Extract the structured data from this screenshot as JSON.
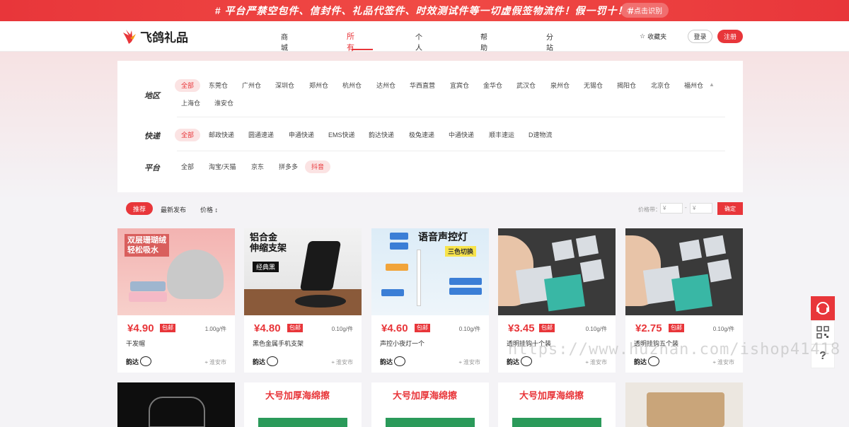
{
  "banner": {
    "text": "# 平台严禁空包件、信封件、礼品代签件、时效测试件等一切虚假签物流件！假一罚十！#",
    "button": "点击识别"
  },
  "header": {
    "logo": "飞鸽礼品",
    "nav": [
      {
        "label": "商城首页"
      },
      {
        "label": "所有商品"
      },
      {
        "label": "个人中心"
      },
      {
        "label": "帮助中心"
      },
      {
        "label": "分站加盟"
      }
    ],
    "favorites": "收藏夹",
    "login": "登录",
    "register": "注册"
  },
  "filters": {
    "region_label": "地区",
    "region_options": [
      "全部",
      "东莞仓",
      "广州仓",
      "深圳仓",
      "郑州仓",
      "杭州仓",
      "达州仓",
      "华西直营",
      "宜宾仓",
      "金华仓",
      "武汉仓",
      "泉州仓",
      "无锡仓",
      "揭阳仓",
      "北京仓",
      "福州仓",
      "上海仓",
      "淮安仓"
    ],
    "express_label": "快递",
    "express_options": [
      "全部",
      "邮政快递",
      "圆通速递",
      "申通快递",
      "EMS快递",
      "韵达快递",
      "极兔速递",
      "中通快递",
      "顺丰速运",
      "D速物流"
    ],
    "platform_label": "平台",
    "platform_options": [
      "全部",
      "淘宝/天猫",
      "京东",
      "拼多多",
      "抖音"
    ]
  },
  "sort": {
    "recommend": "推荐",
    "latest": "最新发布",
    "price": "价格",
    "price_range_label": "价格带：",
    "min_placeholder": "¥",
    "max_placeholder": "¥",
    "confirm": "确定"
  },
  "products": [
    {
      "price": "¥4.90",
      "tag": "包邮",
      "weight": "1.00g/件",
      "name": "干发帽",
      "courier": "韵达",
      "location": "淮安市",
      "img_text1": "双层珊瑚绒",
      "img_text2": "轻松吸水"
    },
    {
      "price": "¥4.80",
      "tag": "包邮",
      "weight": "0.10g/件",
      "name": "黑色金属手机支架",
      "courier": "韵达",
      "location": "淮安市",
      "img_text1": "铝合金",
      "img_text2": "伸缩支架",
      "img_text3": "经典黑"
    },
    {
      "price": "¥4.60",
      "tag": "包邮",
      "weight": "0.10g/件",
      "name": "声控小夜灯一个",
      "courier": "韵达",
      "location": "淮安市",
      "img_text1": "语音声控灯",
      "img_text2": "三色切换"
    },
    {
      "price": "¥3.45",
      "tag": "包邮",
      "weight": "0.10g/件",
      "name": "透明挂钩十个装",
      "courier": "韵达",
      "location": "淮安市"
    },
    {
      "price": "¥2.75",
      "tag": "包邮",
      "weight": "0.10g/件",
      "name": "透明挂钩五个装",
      "courier": "韵达",
      "location": "淮安市"
    }
  ],
  "row2": [
    {
      "img_text": ""
    },
    {
      "img_text": "大号加厚海绵擦"
    },
    {
      "img_text": "大号加厚海绵擦"
    },
    {
      "img_text": "大号加厚海绵擦"
    },
    {
      "img_text": ""
    }
  ],
  "watermark": "https://www.huzhan.com/ishop41418",
  "colors": {
    "accent": "#e8363a",
    "tag_bg": "#fbe3e3"
  }
}
